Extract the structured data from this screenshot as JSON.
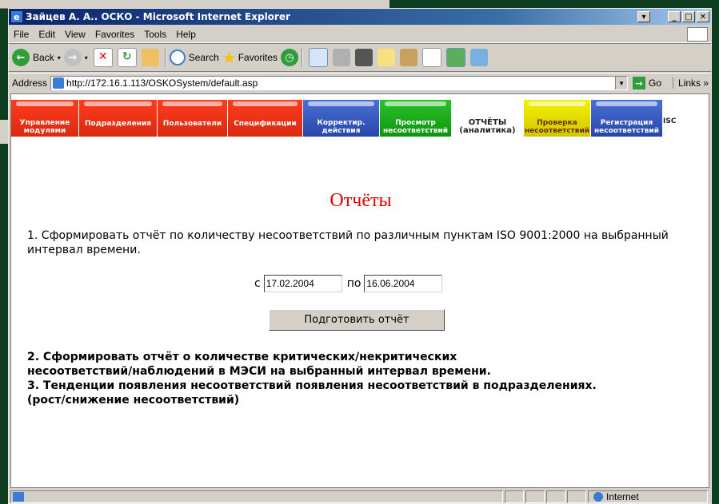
{
  "window": {
    "title": "Зайцев А. А.. ОСКО - Microsoft Internet Explorer"
  },
  "menu": [
    "File",
    "Edit",
    "View",
    "Favorites",
    "Tools",
    "Help"
  ],
  "toolbar": {
    "back": "Back",
    "search": "Search",
    "favorites": "Favorites"
  },
  "address": {
    "label": "Address",
    "url": "http://172.16.1.113/OSKOSystem/default.asp",
    "go": "Go",
    "links": "Links"
  },
  "nav": [
    {
      "line1": "Управление",
      "line2": "модулями",
      "color": "red"
    },
    {
      "line1": "Подразделения",
      "line2": "",
      "color": "red"
    },
    {
      "line1": "Пользователи",
      "line2": "",
      "color": "red"
    },
    {
      "line1": "Спецификации",
      "line2": "",
      "color": "red"
    },
    {
      "line1": "Корректир.",
      "line2": "действия",
      "color": "blue"
    },
    {
      "line1": "Просмотр",
      "line2": "несоответствий",
      "color": "green"
    },
    {
      "line1": "ОТЧЁТЫ",
      "line2": "(аналитика)",
      "color": "white"
    },
    {
      "line1": "Проверка",
      "line2": "несоответствий",
      "color": "yellow"
    },
    {
      "line1": "Регистрация",
      "line2": "несоответствий",
      "color": "blue"
    },
    {
      "line1": "ISC",
      "line2": "",
      "color": "white"
    }
  ],
  "page": {
    "title": "Отчёты",
    "item1": "1. Сформировать отчёт по количеству несоответствий по различным пунктам ISO 9001:2000 на выбранный интервал времени.",
    "from_label": "с",
    "from_value": "17.02.2004",
    "to_label": "по",
    "to_value": "16.06.2004",
    "button": "Подготовить отчёт",
    "item2a": "2. Сформировать отчёт о количестве критических/некритических",
    "item2b": "несоответствий/наблюдений в МЭСИ на выбранный интервал времени.",
    "item3a": "3. Тенденции появления несоответствий появления несоответствий в подразделениях.",
    "item3b": "(рост/снижение несоответствий)"
  },
  "status": {
    "zone": "Internet"
  }
}
